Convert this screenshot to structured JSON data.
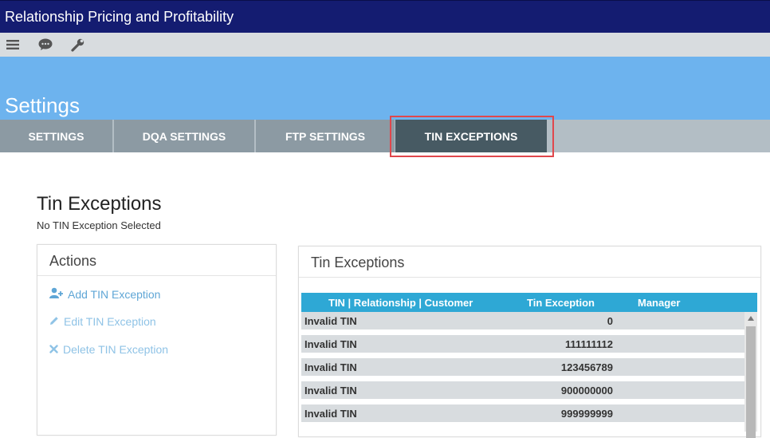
{
  "app": {
    "title": "Relationship Pricing and Profitability"
  },
  "toolbar": {
    "icons": [
      "menu-icon",
      "chat-icon",
      "wrench-icon"
    ]
  },
  "hero": {
    "title": "Settings"
  },
  "tabs": [
    {
      "label": "SETTINGS",
      "active": false
    },
    {
      "label": "DQA SETTINGS",
      "active": false
    },
    {
      "label": "FTP SETTINGS",
      "active": false
    },
    {
      "label": "TIN EXCEPTIONS",
      "active": true
    }
  ],
  "page": {
    "title": "Tin Exceptions",
    "subtitle": "No TIN Exception Selected"
  },
  "actions": {
    "title": "Actions",
    "items": [
      {
        "label": "Add TIN Exception",
        "icon": "add-user-icon",
        "enabled": true
      },
      {
        "label": "Edit TIN Exception",
        "icon": "pencil-icon",
        "enabled": false
      },
      {
        "label": "Delete TIN Exception",
        "icon": "x-icon",
        "enabled": false
      }
    ]
  },
  "grid": {
    "title": "Tin Exceptions",
    "columns": [
      "TIN | Relationship | Customer",
      "Tin Exception",
      "Manager"
    ],
    "rows": [
      {
        "name": "Invalid TIN",
        "exception": "0",
        "manager": ""
      },
      {
        "name": "Invalid TIN",
        "exception": "111111112",
        "manager": ""
      },
      {
        "name": "Invalid TIN",
        "exception": "123456789",
        "manager": ""
      },
      {
        "name": "Invalid TIN",
        "exception": "900000000",
        "manager": ""
      },
      {
        "name": "Invalid TIN",
        "exception": "999999999",
        "manager": ""
      }
    ]
  },
  "colors": {
    "titlebar": "#141c71",
    "hero": "#6db3ee",
    "tab": "#8c9aa3",
    "tab_active": "#475a63",
    "grid_header": "#2ea8d5",
    "highlight_outline": "#e0474c"
  }
}
